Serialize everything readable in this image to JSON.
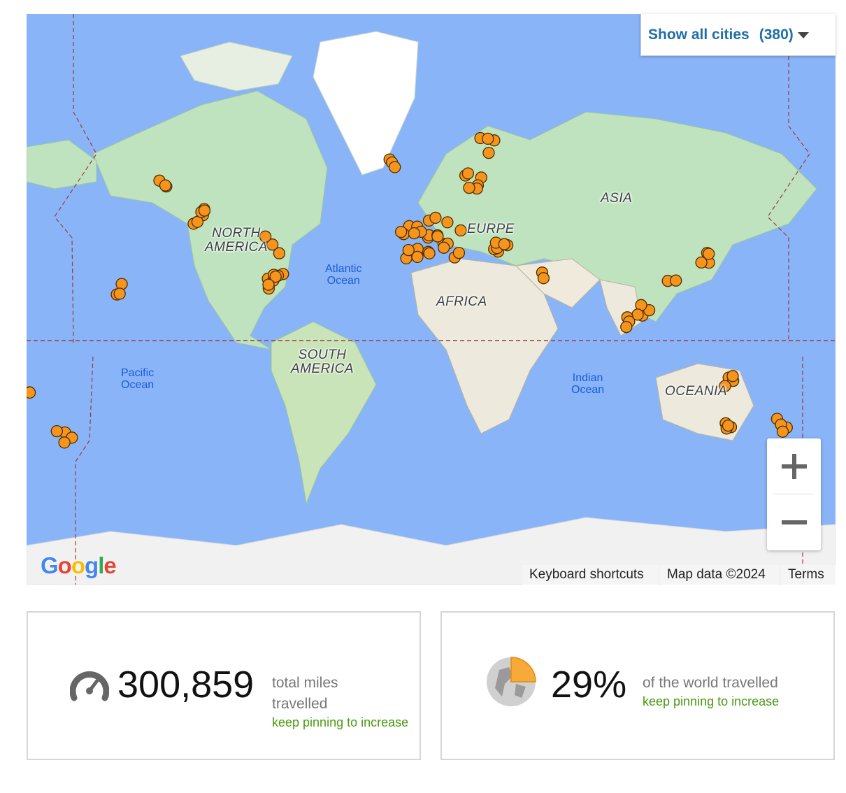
{
  "map": {
    "continent_labels": [
      "NORTH\nAMERICA",
      "SOUTH\nAMERICA",
      "AFRICA",
      "ASIA",
      "OCEANIA",
      "EURPE"
    ],
    "ocean_labels": [
      "Atlantic\nOcean",
      "Pacific\nOcean",
      "Indian\nOcean"
    ],
    "show_all": {
      "label": "Show all cities",
      "count": "(380)"
    },
    "attribution": {
      "keyboard": "Keyboard shortcuts",
      "map_data": "Map data ©2024",
      "terms": "Terms"
    },
    "google_logo": "Google",
    "colors": {
      "water": "#8ab4f8",
      "land": "#bfe3bf",
      "pin": "#f7941d",
      "pin_border": "#4a3000"
    }
  },
  "stats": {
    "miles": {
      "icon": "speedometer-icon",
      "value": "300,859",
      "desc": "total miles travelled",
      "hint": "keep pinning to increase"
    },
    "world": {
      "icon": "globe-pie-icon",
      "value": "29%",
      "desc": "of the world travelled",
      "hint": "keep pinning to increase",
      "fraction": 0.29
    }
  }
}
